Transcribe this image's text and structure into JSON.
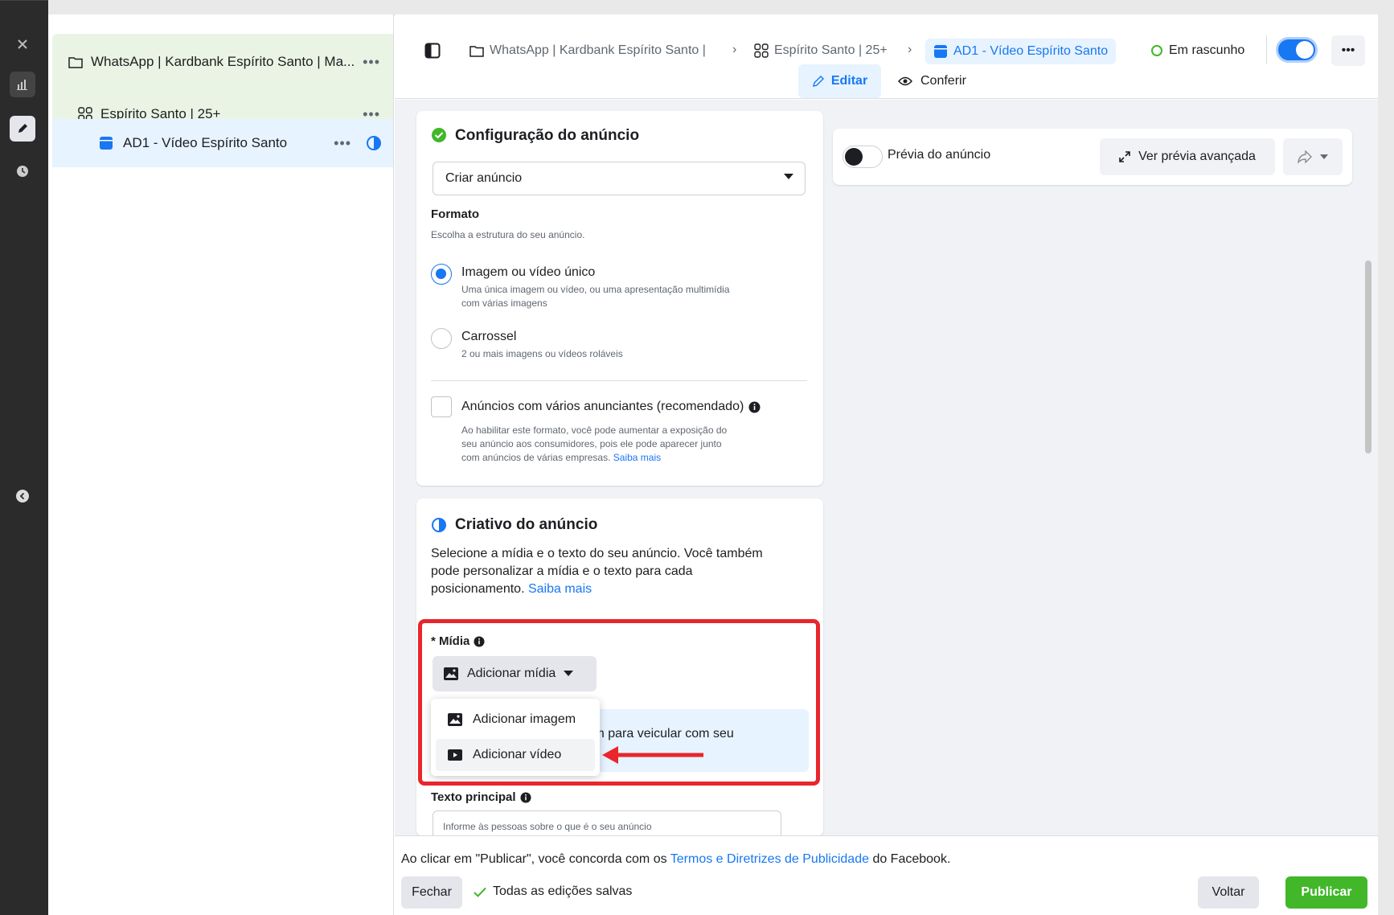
{
  "colors": {
    "brand_blue": "#1877f2",
    "publish_green": "#42b72a",
    "highlight_red": "#e8262b",
    "draft_green": "#42b72a"
  },
  "sidebar": {
    "campaign": {
      "icon": "folder-icon",
      "label": "WhatsApp | Kardbank Espírito Santo | Ma...",
      "more": "•••"
    },
    "adset": {
      "icon": "adset-grid-icon",
      "label": "Espírito Santo | 25+",
      "more": "•••"
    },
    "ad": {
      "icon": "ad-icon",
      "label": "AD1 - Vídeo Espírito Santo",
      "more": "•••"
    }
  },
  "topbar": {
    "breadcrumbs": [
      {
        "icon": "folder-icon",
        "label": "WhatsApp | Kardbank Espírito Santo |"
      },
      {
        "icon": "adset-grid-icon",
        "label": "Espírito Santo | 25+"
      },
      {
        "icon": "ad-icon",
        "label": "AD1 - Vídeo Espírito Santo"
      }
    ],
    "status": "Em rascunho",
    "tabs": {
      "edit": "Editar",
      "review": "Conferir"
    },
    "more": "•••"
  },
  "ad_setup": {
    "title": "Configuração do anúncio",
    "select_value": "Criar anúncio",
    "format_label": "Formato",
    "format_help": "Escolha a estrutura do seu anúncio.",
    "options": [
      {
        "label": "Imagem ou vídeo único",
        "desc1": "Uma única imagem ou vídeo, ou uma apresentação multimídia",
        "desc2": "com várias imagens",
        "selected": true
      },
      {
        "label": "Carrossel",
        "desc1": "2 ou mais imagens ou vídeos roláveis",
        "selected": false
      }
    ],
    "multi_advertiser": {
      "label": "Anúncios com vários anunciantes (recomendado)",
      "desc1": "Ao habilitar este formato, você pode aumentar a exposição do",
      "desc2": "seu anúncio aos consumidores, pois ele pode aparecer junto",
      "desc3": "com anúncios de várias empresas.",
      "link": "Saiba mais"
    }
  },
  "creative": {
    "title": "Criativo do anúncio",
    "desc1": "Selecione a mídia e o texto do seu anúncio. Você também",
    "desc2": "pode personalizar a mídia e o texto para cada",
    "desc3": "posicionamento.",
    "link": "Saiba mais",
    "media_label": "* Mídia",
    "add_media": "Adicionar mídia",
    "menu": {
      "add_image": "Adicionar imagem",
      "add_video": "Adicionar vídeo"
    },
    "banner_text": "jem para veicular com seu",
    "primary_text_label": "Texto principal",
    "primary_text_placeholder": "Informe às pessoas sobre o que é o seu anúncio"
  },
  "preview": {
    "toggle_label": "Prévia do anúncio",
    "advanced_button": "Ver prévia avançada"
  },
  "footer": {
    "terms_pre": "Ao clicar em \"Publicar\", você concorda com os",
    "terms_link": "Termos e Diretrizes de Publicidade",
    "terms_post": "do Facebook.",
    "close": "Fechar",
    "saved": "Todas as edições salvas",
    "back": "Voltar",
    "publish": "Publicar"
  }
}
